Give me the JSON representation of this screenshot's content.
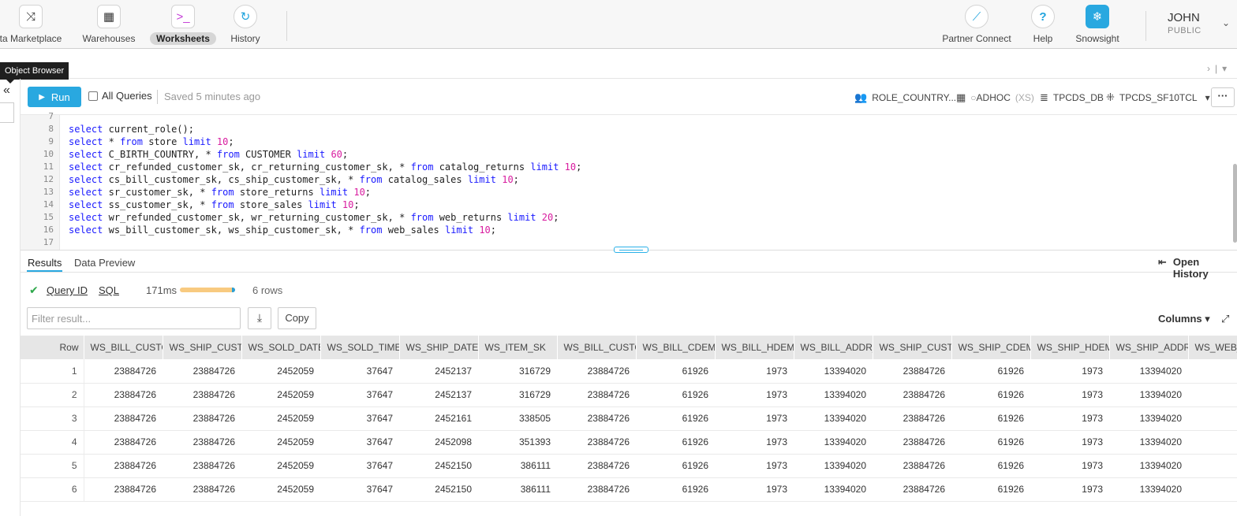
{
  "nav": {
    "items": [
      {
        "label": "ta Marketplace",
        "icon": "shuffle-icon"
      },
      {
        "label": "Warehouses",
        "icon": "grid-icon"
      },
      {
        "label": "Worksheets",
        "icon": "terminal-icon",
        "active": true
      },
      {
        "label": "History",
        "icon": "history-icon"
      }
    ],
    "right_items": [
      {
        "label": "Partner Connect",
        "icon": "partner-icon"
      },
      {
        "label": "Help",
        "icon": "help-icon"
      },
      {
        "label": "Snowsight",
        "icon": "snowflake-icon"
      }
    ],
    "user_name": "JOHN",
    "user_role": "PUBLIC"
  },
  "tooltip": "Object Browser",
  "toolbar": {
    "run_label": "Run",
    "all_queries_label": "All Queries",
    "saved_text": "Saved 5 minutes ago",
    "role": "ROLE_COUNTRY...",
    "warehouse": "ADHOC",
    "warehouse_size": "(XS)",
    "database": "TPCDS_DB",
    "schema": "TPCDS_SF10TCL"
  },
  "editor": {
    "lines": [
      {
        "n": "7",
        "code": ""
      },
      {
        "n": "8",
        "code": "select current_role();"
      },
      {
        "n": "9",
        "code": "select * from store limit 10;"
      },
      {
        "n": "10",
        "code": "select C_BIRTH_COUNTRY, * from CUSTOMER limit 60;"
      },
      {
        "n": "11",
        "code": "select cr_refunded_customer_sk, cr_returning_customer_sk, * from catalog_returns limit 10;"
      },
      {
        "n": "12",
        "code": "select cs_bill_customer_sk, cs_ship_customer_sk, * from catalog_sales limit 10;"
      },
      {
        "n": "13",
        "code": "select sr_customer_sk, * from store_returns limit 10;"
      },
      {
        "n": "14",
        "code": "select ss_customer_sk, * from store_sales limit 10;"
      },
      {
        "n": "15",
        "code": "select wr_refunded_customer_sk, wr_returning_customer_sk, * from web_returns limit 20;"
      },
      {
        "n": "16",
        "code": "select ws_bill_customer_sk, ws_ship_customer_sk, * from web_sales limit 10;"
      },
      {
        "n": "17",
        "code": ""
      }
    ]
  },
  "results": {
    "tab_results": "Results",
    "tab_preview": "Data Preview",
    "open_history": "Open History",
    "query_id_label": "Query ID",
    "sql_label": "SQL",
    "duration": "171ms",
    "row_count": "6 rows",
    "filter_placeholder": "Filter result...",
    "copy_label": "Copy",
    "columns_label": "Columns",
    "columns": [
      "Row",
      "WS_BILL_CUSTO",
      "WS_SHIP_CUSTO",
      "WS_SOLD_DATE_",
      "WS_SOLD_TIME_",
      "WS_SHIP_DATE_",
      "WS_ITEM_SK",
      "WS_BILL_CUSTO",
      "WS_BILL_CDEMO",
      "WS_BILL_HDEM",
      "WS_BILL_ADDR_",
      "WS_SHIP_CUSTO",
      "WS_SHIP_CDEM",
      "WS_SHIP_HDEM",
      "WS_SHIP_ADDR",
      "WS_WEB_"
    ],
    "rows": [
      [
        "1",
        "23884726",
        "23884726",
        "2452059",
        "37647",
        "2452137",
        "316729",
        "23884726",
        "61926",
        "1973",
        "13394020",
        "23884726",
        "61926",
        "1973",
        "13394020",
        ""
      ],
      [
        "2",
        "23884726",
        "23884726",
        "2452059",
        "37647",
        "2452137",
        "316729",
        "23884726",
        "61926",
        "1973",
        "13394020",
        "23884726",
        "61926",
        "1973",
        "13394020",
        ""
      ],
      [
        "3",
        "23884726",
        "23884726",
        "2452059",
        "37647",
        "2452161",
        "338505",
        "23884726",
        "61926",
        "1973",
        "13394020",
        "23884726",
        "61926",
        "1973",
        "13394020",
        ""
      ],
      [
        "4",
        "23884726",
        "23884726",
        "2452059",
        "37647",
        "2452098",
        "351393",
        "23884726",
        "61926",
        "1973",
        "13394020",
        "23884726",
        "61926",
        "1973",
        "13394020",
        ""
      ],
      [
        "5",
        "23884726",
        "23884726",
        "2452059",
        "37647",
        "2452150",
        "386111",
        "23884726",
        "61926",
        "1973",
        "13394020",
        "23884726",
        "61926",
        "1973",
        "13394020",
        ""
      ],
      [
        "6",
        "23884726",
        "23884726",
        "2452059",
        "37647",
        "2452150",
        "386111",
        "23884726",
        "61926",
        "1973",
        "13394020",
        "23884726",
        "61926",
        "1973",
        "13394020",
        ""
      ]
    ]
  },
  "colors": {
    "accent": "#29a8e0",
    "success": "#2ea84b",
    "duration_bar": "#f8ca80"
  }
}
